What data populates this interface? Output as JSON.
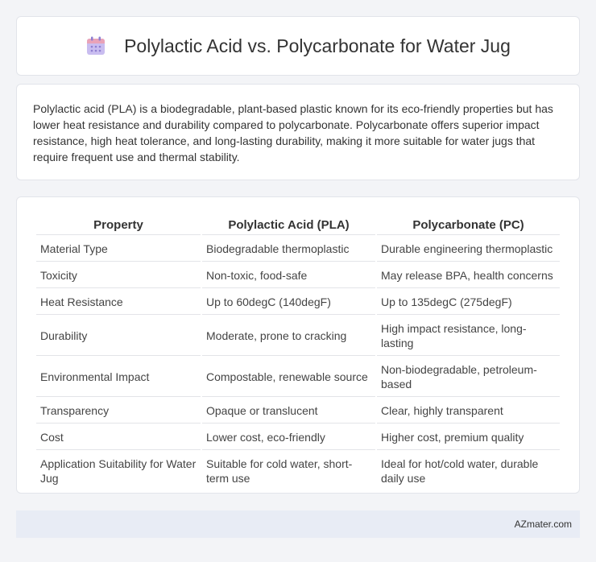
{
  "header": {
    "title": "Polylactic Acid vs. Polycarbonate for Water Jug",
    "icon": "calendar-icon"
  },
  "intro": {
    "text": "Polylactic acid (PLA) is a biodegradable, plant-based plastic known for its eco-friendly properties but has lower heat resistance and durability compared to polycarbonate. Polycarbonate offers superior impact resistance, high heat tolerance, and long-lasting durability, making it more suitable for water jugs that require frequent use and thermal stability."
  },
  "table": {
    "headers": [
      "Property",
      "Polylactic Acid (PLA)",
      "Polycarbonate (PC)"
    ],
    "rows": [
      [
        "Material Type",
        "Biodegradable thermoplastic",
        "Durable engineering thermoplastic"
      ],
      [
        "Toxicity",
        "Non-toxic, food-safe",
        "May release BPA, health concerns"
      ],
      [
        "Heat Resistance",
        "Up to 60degC (140degF)",
        "Up to 135degC (275degF)"
      ],
      [
        "Durability",
        "Moderate, prone to cracking",
        "High impact resistance, long-lasting"
      ],
      [
        "Environmental Impact",
        "Compostable, renewable source",
        "Non-biodegradable, petroleum-based"
      ],
      [
        "Transparency",
        "Opaque or translucent",
        "Clear, highly transparent"
      ],
      [
        "Cost",
        "Lower cost, eco-friendly",
        "Higher cost, premium quality"
      ],
      [
        "Application Suitability for Water Jug",
        "Suitable for cold water, short-term use",
        "Ideal for hot/cold water, durable daily use"
      ]
    ]
  },
  "footer": {
    "brand": "AZmater.com"
  },
  "colors": {
    "background": "#f3f4f7",
    "card": "#ffffff",
    "footer": "#e8ecf5",
    "icon_top": "#e8a0b4",
    "icon_body": "#b9a6e6"
  }
}
